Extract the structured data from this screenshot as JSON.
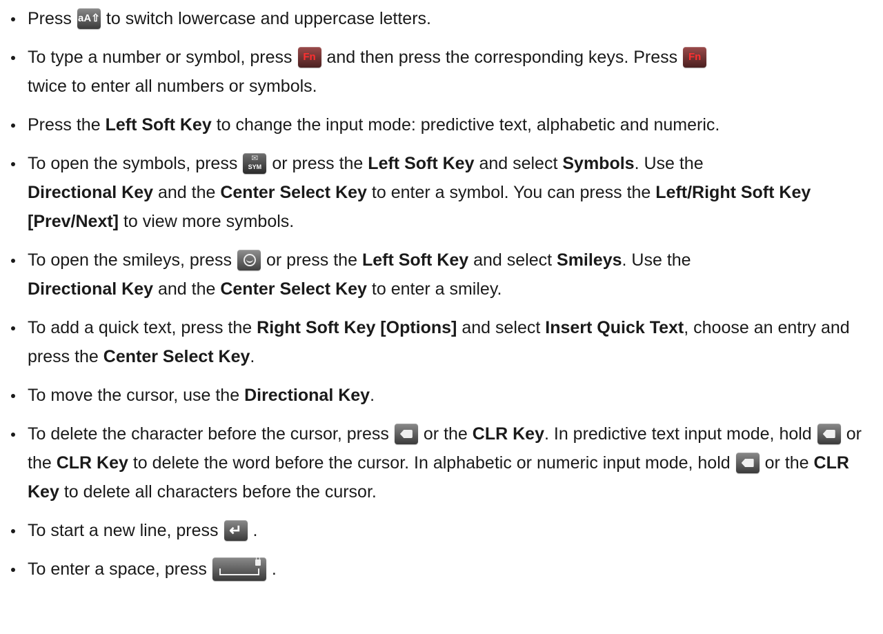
{
  "items": [
    {
      "p": [
        "Press",
        "to switch lowercase and uppercase letters."
      ]
    },
    {
      "p": [
        "To type a number or symbol, press",
        "and then press the corresponding keys. Press",
        "twice to enter all numbers or symbols."
      ]
    },
    {
      "p": [
        "Press the",
        "Left Soft Key",
        "to change the input mode: predictive text, alphabetic and numeric."
      ]
    },
    {
      "p": [
        "To open the symbols, press",
        "or press the",
        "Left Soft Key",
        "and select",
        "Symbols",
        ". Use the",
        "Directional Key",
        "and the",
        "Center Select Key",
        "to enter a symbol. You can press the",
        "Left/Right Soft Key [Prev/Next]",
        "to view more symbols."
      ]
    },
    {
      "p": [
        "To open the smileys, press",
        "or press the",
        "Left Soft Key",
        "and select",
        "Smileys",
        ". Use the",
        "Directional Key",
        "and the",
        "Center Select Key",
        "to enter a smiley."
      ]
    },
    {
      "p": [
        "To add a quick text, press the",
        "Right Soft Key [Options]",
        "and select",
        "Insert Quick Text",
        ", choose an entry and press the",
        "Center Select Key",
        "."
      ]
    },
    {
      "p": [
        "To move the cursor, use the",
        "Directional Key",
        "."
      ]
    },
    {
      "p": [
        "To delete the character before the cursor, press",
        "or the",
        "CLR Key",
        ". In predictive text input mode, hold",
        "or the",
        "CLR Key",
        "to delete the word before the cursor. In alphabetic or numeric input mode, hold",
        "or the",
        "CLR Key",
        "to delete all characters before the cursor."
      ]
    },
    {
      "p": [
        "To start a new line, press",
        "."
      ]
    },
    {
      "p": [
        "To enter a space, press",
        "."
      ]
    }
  ],
  "keys": {
    "shift": "aA⇧",
    "fn": "Fn",
    "sym": "SYM",
    "envelope": "✉",
    "enter": "↵"
  },
  "icons": {
    "shift": "shift-key-icon",
    "fn": "fn-key-icon",
    "sym": "sym-key-icon",
    "smiley": "smiley-key-icon",
    "delete": "delete-key-icon",
    "enter": "enter-key-icon",
    "space": "space-key-icon"
  }
}
